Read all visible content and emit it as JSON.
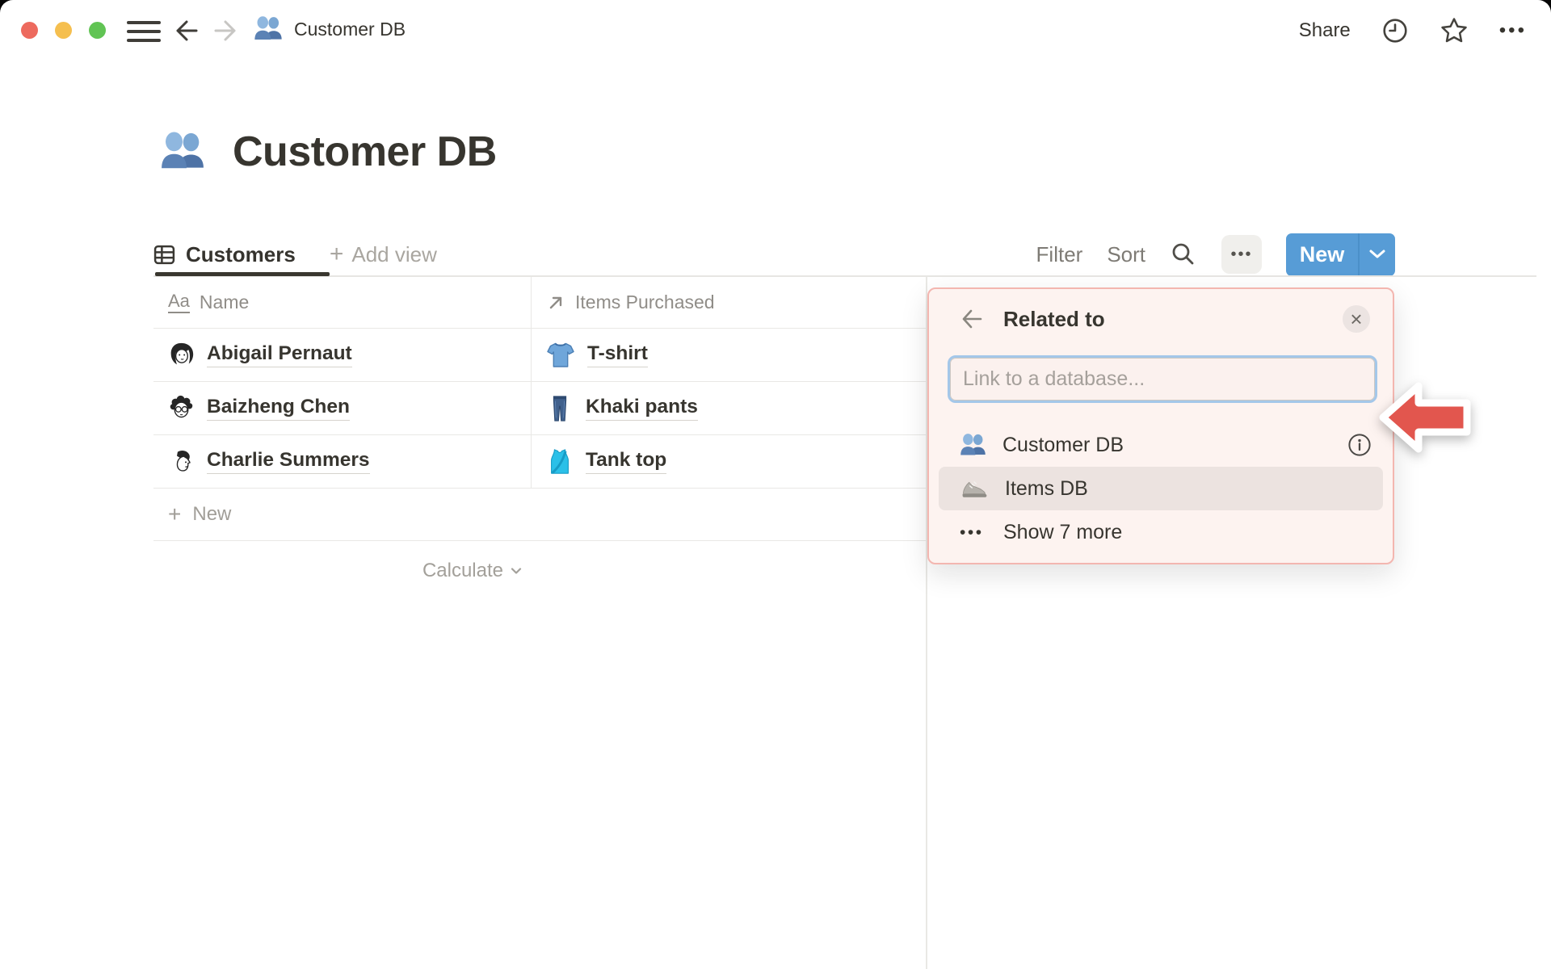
{
  "titlebar": {
    "breadcrumb": "Customer DB",
    "share_label": "Share"
  },
  "page": {
    "title": "Customer DB"
  },
  "view_bar": {
    "tab_label": "Customers",
    "add_view_label": "Add view",
    "filter_label": "Filter",
    "sort_label": "Sort",
    "new_label": "New"
  },
  "table": {
    "columns": [
      {
        "label": "Name"
      },
      {
        "label": "Items Purchased"
      }
    ],
    "rows": [
      {
        "name": "Abigail Pernaut",
        "item": "T-shirt"
      },
      {
        "name": "Baizheng Chen",
        "item": "Khaki pants"
      },
      {
        "name": "Charlie Summers",
        "item": "Tank top"
      }
    ],
    "new_row_label": "New",
    "calculate_label": "Calculate"
  },
  "popup": {
    "title": "Related to",
    "input_placeholder": "Link to a database...",
    "options": [
      {
        "label": "Customer DB"
      },
      {
        "label": "Items DB"
      },
      {
        "label": "Show 7 more"
      }
    ]
  },
  "icons": {
    "more_dots": "•••",
    "plus": "+",
    "close": "×"
  },
  "colors": {
    "accent_blue": "#579CD6",
    "popup_border": "#F3B6B0",
    "popup_bg": "#FDF3F0",
    "highlight_row": "#ECE3E0",
    "arrow_red": "#E2564E",
    "traffic_red": "#ED6A5E",
    "traffic_yellow": "#F5BF4F",
    "traffic_green": "#61C454"
  }
}
